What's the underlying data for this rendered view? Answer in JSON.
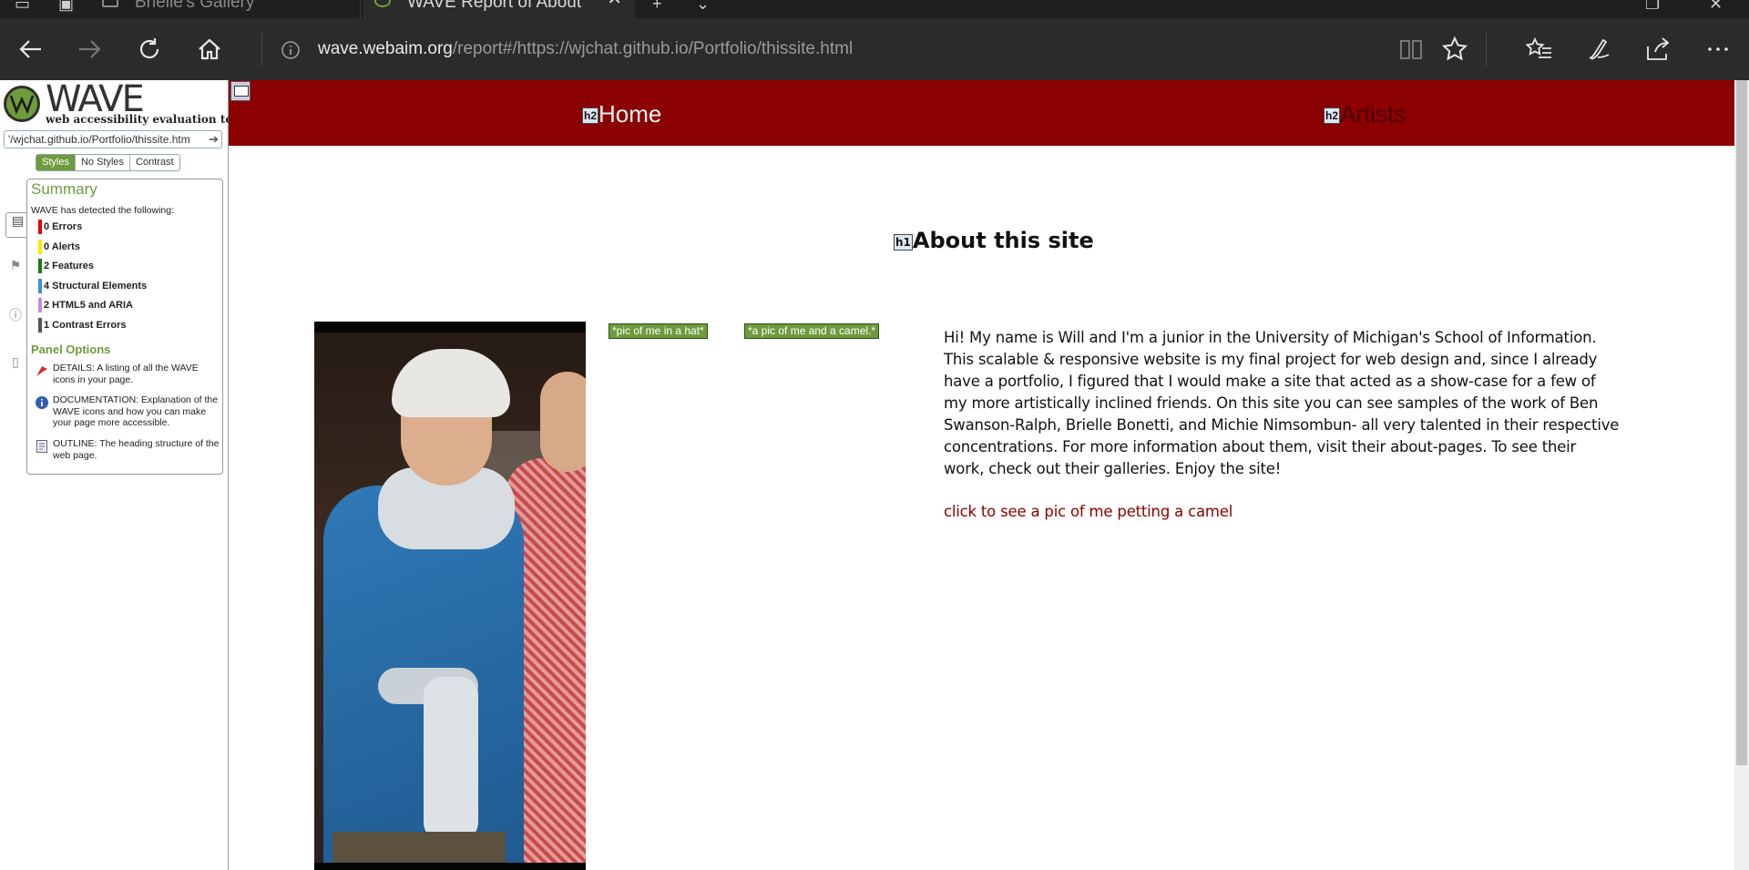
{
  "browser": {
    "tabs": [
      {
        "label": "Brielle's Gallery",
        "active": false
      },
      {
        "label": "WAVE Report of About",
        "active": true
      }
    ],
    "address": {
      "host": "wave.webaim.org",
      "path": "/report#/https://wjchat.github.io/Portfolio/thissite.html"
    },
    "icons": [
      "back-icon",
      "forward-icon",
      "refresh-icon",
      "home-icon",
      "info-icon",
      "reading-view-icon",
      "favorite-star-icon",
      "favorites-hub-icon",
      "pen-icon",
      "share-icon",
      "more-icon"
    ]
  },
  "wave": {
    "title": "WAVE",
    "subtitle": "web accessibility evaluation tool",
    "url_value": "'/wjchat.github.io/Portfolio/thissite.htm",
    "modes": [
      "Styles",
      "No Styles",
      "Contrast"
    ],
    "summary_heading": "Summary",
    "detected_text": "WAVE has detected the following:",
    "results": [
      {
        "label": "0 Errors",
        "color": "#e00000"
      },
      {
        "label": "0 Alerts",
        "color": "#ffe600"
      },
      {
        "label": "2 Features",
        "color": "#1a7a1a"
      },
      {
        "label": "4 Structural Elements",
        "color": "#3a8fd9"
      },
      {
        "label": "2 HTML5 and ARIA",
        "color": "#c98bd9"
      },
      {
        "label": "1 Contrast Errors",
        "color": "#555555"
      }
    ],
    "panel_options_heading": "Panel Options",
    "options": [
      {
        "icon": "flag-icon",
        "text": "DETAILS: A listing of all the WAVE icons in your page."
      },
      {
        "icon": "info-icon",
        "text": "DOCUMENTATION: Explanation of the WAVE icons and how you can make your page more accessible."
      },
      {
        "icon": "outline-icon",
        "text": "OUTLINE: The heading structure of the web page."
      }
    ]
  },
  "page": {
    "nav": {
      "home_tag": "h2",
      "home": "Home",
      "artists_tag": "h2",
      "artists": "Artists"
    },
    "heading_tag": "h1",
    "heading": "About this site",
    "alt_badges": [
      "*pic of me in a hat*",
      "*a pic of me and a camel.*"
    ],
    "about": "Hi! My name is Will and I'm a junior in the University of Michigan's School of Information. This scalable & responsive website is my final project for web design and, since I already have a portfolio, I figured that I would make a site that acted as a show-case for a few of my more artistically inclined friends. On this site you can see samples of the work of Ben Swanson-Ralph, Brielle Bonetti, and Michie Nimsombun- all very talented in their respective concentrations. For more information about them, visit their about-pages. To see their work, check out their galleries. Enjoy the site!",
    "camel_link": "click to see a pic of me petting a camel"
  },
  "colors": {
    "nav_bg": "#8b0000",
    "wave_green": "#6e9b3d",
    "link": "#8b0000"
  }
}
